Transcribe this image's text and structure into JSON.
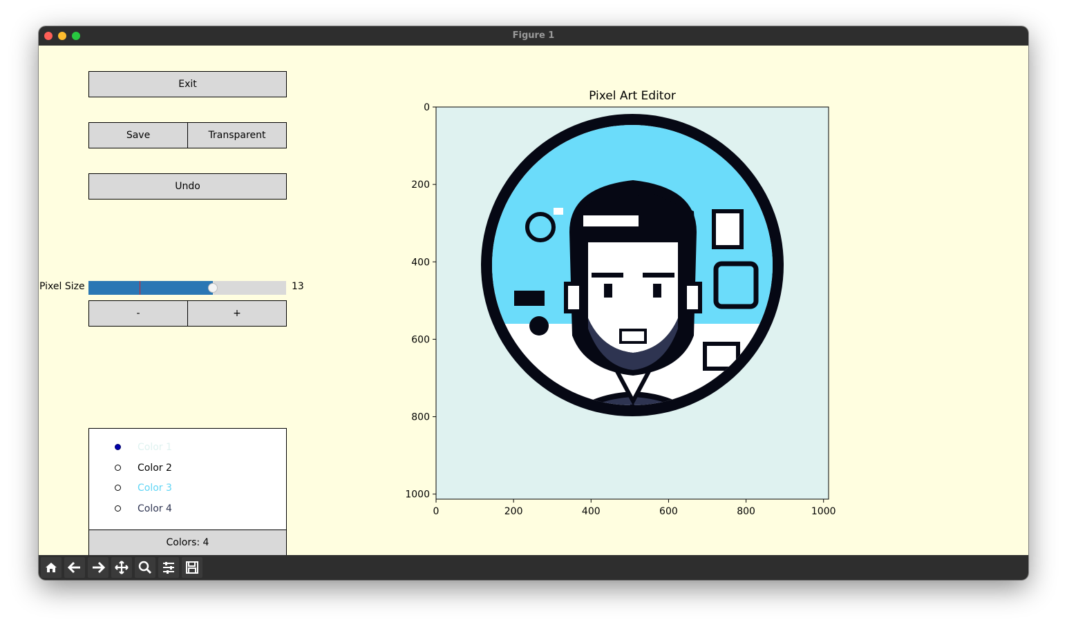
{
  "window": {
    "title": "Figure 1"
  },
  "buttons": {
    "exit": "Exit",
    "save": "Save",
    "transparent": "Transparent",
    "undo": "Undo",
    "minus": "-",
    "plus": "+"
  },
  "slider": {
    "label": "Pixel Size",
    "value": 13,
    "value_text": "13",
    "fill_fraction": 0.63,
    "initial_fraction": 0.26,
    "colors": {
      "fill": "#2a77b4",
      "track": "#d9d9d9",
      "init_marker": "#e02020"
    }
  },
  "palette": {
    "items": [
      {
        "label": "Color 1",
        "color": "#dff2f0",
        "selected": true
      },
      {
        "label": "Color 2",
        "color": "#000000",
        "selected": false
      },
      {
        "label": "Color 3",
        "color": "#5fd5f5",
        "selected": false
      },
      {
        "label": "Color 4",
        "color": "#2e3451",
        "selected": false
      }
    ],
    "count_text": "Colors: 4"
  },
  "plot": {
    "title": "Pixel Art Editor",
    "x_ticks": [
      "0",
      "200",
      "400",
      "600",
      "800",
      "1000"
    ],
    "y_ticks": [
      "0",
      "200",
      "400",
      "600",
      "800",
      "1000"
    ],
    "image_colors": {
      "background": "#dff2f0",
      "sky": "#6bdcfa",
      "ink": "#060814",
      "navy": "#2e3451",
      "white": "#ffffff"
    }
  },
  "toolbar": {
    "tools": [
      "home-icon",
      "back-icon",
      "forward-icon",
      "pan-icon",
      "zoom-icon",
      "configure-icon",
      "save-icon"
    ]
  }
}
